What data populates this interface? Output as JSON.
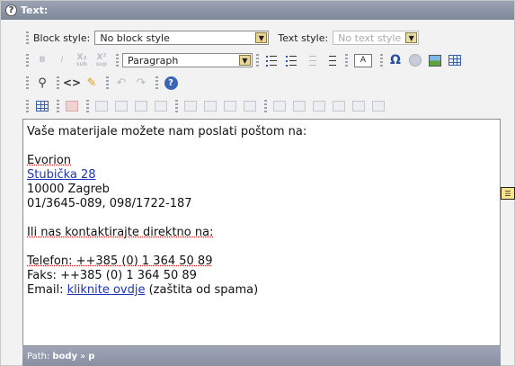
{
  "title_bar": {
    "label": "Text:"
  },
  "toolbar": {
    "block_style_label": "Block style:",
    "block_style_value": "No block style",
    "text_style_label": "Text style:",
    "text_style_value": "No text style",
    "format_value": "Paragraph",
    "bold": "B",
    "italic": "I",
    "subscript": "X₂",
    "superscript": "X²",
    "sub_caption": "sub",
    "sup_caption": "sup",
    "color_label": "A",
    "omega": "Ω",
    "source": "<>"
  },
  "editor": {
    "line1": "Vaše materijale možete nam poslati poštom na:",
    "company": "Evorion",
    "street": "Stubička 28",
    "city": "10000 Zagreb",
    "phones": "01/3645-089, 098/1722-187",
    "contact_intro": "Ili nas kontaktirajte direktno na:",
    "phone_line": "Telefon: ++385 (0) 1 364 50 89",
    "fax_line": "Faks: ++385 (0) 1 364 50 89",
    "email_label": "Email: ",
    "email_link": "kliknite ovdje",
    "email_note": " (zaštita od spama)"
  },
  "path_bar": {
    "label": "Path:",
    "segment1": "body",
    "arrow": "»",
    "segment2": "p"
  },
  "colors": {
    "titlebar": "#8a93a5",
    "link": "#1d33b3",
    "combo_arrow": "#e7d59a"
  }
}
